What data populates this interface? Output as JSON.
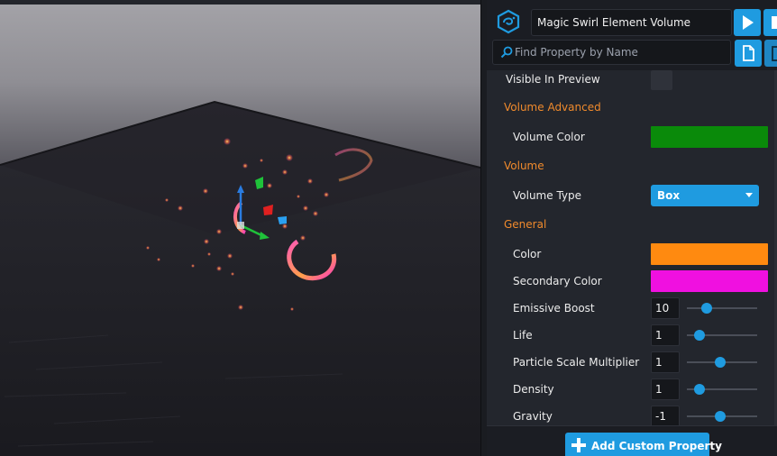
{
  "header": {
    "object_name": "Magic Swirl Element Volume",
    "search_placeholder": "Find Property by Name"
  },
  "properties": {
    "visible_in_preview": {
      "label": "Visible In Preview",
      "checked": false
    },
    "sections": {
      "volume_advanced": "Volume Advanced",
      "volume": "Volume",
      "general": "General"
    },
    "volume_color": {
      "label": "Volume Color",
      "color": "#0a8a0a"
    },
    "volume_type": {
      "label": "Volume Type",
      "value": "Box"
    },
    "color": {
      "label": "Color",
      "color": "#ff8a10"
    },
    "secondary_color": {
      "label": "Secondary Color",
      "color": "#f010e0"
    },
    "sliders": [
      {
        "label": "Emissive Boost",
        "value": "10",
        "fraction": 0.28
      },
      {
        "label": "Life",
        "value": "1",
        "fraction": 0.18
      },
      {
        "label": "Particle Scale Multiplier",
        "value": "1",
        "fraction": 0.48
      },
      {
        "label": "Density",
        "value": "1",
        "fraction": 0.18
      },
      {
        "label": "Gravity",
        "value": "-1",
        "fraction": 0.47
      }
    ]
  },
  "footer": {
    "add_button": "Add Custom Property"
  },
  "colors": {
    "accent": "#1f9be0",
    "section": "#f08a2c",
    "panel": "#23262d"
  }
}
